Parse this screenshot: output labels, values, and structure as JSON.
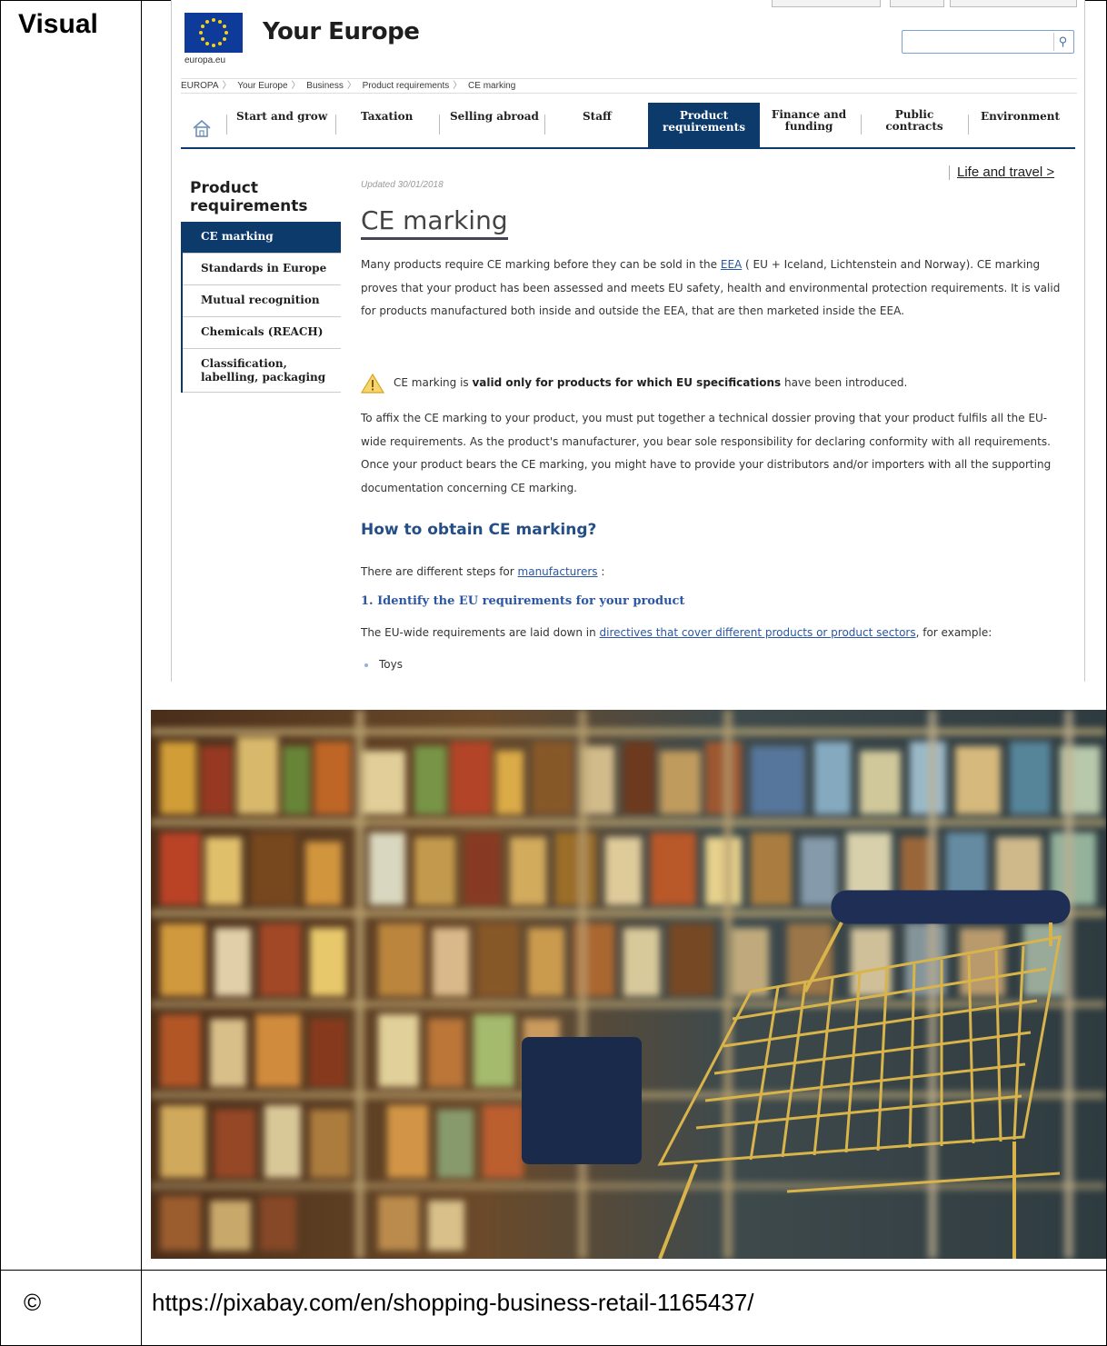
{
  "document": {
    "row_label": "Visual",
    "copyright_symbol": "©",
    "credit_url": "https://pixabay.com/en/shopping-business-retail-1165437/"
  },
  "screenshot": {
    "logo_caption": "europa.eu",
    "site_title": "Your Europe",
    "search": {
      "placeholder": ""
    },
    "breadcrumb": [
      "EUROPA",
      "Your Europe",
      "Business",
      "Product requirements",
      "CE marking"
    ],
    "nav": {
      "items": [
        "Start and grow",
        "Taxation",
        "Selling abroad",
        "Staff",
        "Product requirements",
        "Finance and funding",
        "Public contracts",
        "Environment"
      ],
      "active": "Product requirements"
    },
    "life_travel_link": "Life and travel >",
    "sidebar": {
      "title": "Product requirements",
      "items": [
        "CE marking",
        "Standards in Europe",
        "Mutual recognition",
        "Chemicals (REACH)",
        "Classification, labelling, packaging"
      ]
    },
    "updated": "Updated 30/01/2018",
    "page_title": "CE marking",
    "intro": {
      "before_link": "Many products require CE marking before they can be sold in the ",
      "link": "EEA",
      "after_link": " ( EU + Iceland, Lichtenstein and Norway). CE marking proves that your product has been assessed and meets EU safety, health and environmental protection requirements. It is valid for products manufactured both inside and outside the EEA, that are then marketed inside the EEA."
    },
    "warning": {
      "before": "CE marking is ",
      "bold": "valid only for products for which EU specifications",
      "after": " have been introduced."
    },
    "paragraph2": "To affix the CE marking to your product, you must put together a technical dossier proving that your product fulfils all the EU-wide requirements. As the product's manufacturer, you bear sole responsibility for declaring conformity with all requirements. Once your product bears the CE marking, you might have to provide your distributors and/or importers with all the supporting documentation concerning CE marking.",
    "h2": "How to obtain CE marking?",
    "steps_intro": {
      "before": "There are different steps for ",
      "link": "manufacturers",
      "after": " :"
    },
    "step1_heading": "1. Identify the EU requirements for your product",
    "step1_text": {
      "before": "The EU-wide requirements are laid down in ",
      "link": "directives that cover different products or product sectors",
      "after": ", for example:"
    },
    "bullet1": "Toys"
  },
  "photo": {
    "description_icon": "shopping-cart-in-supermarket-photo"
  }
}
